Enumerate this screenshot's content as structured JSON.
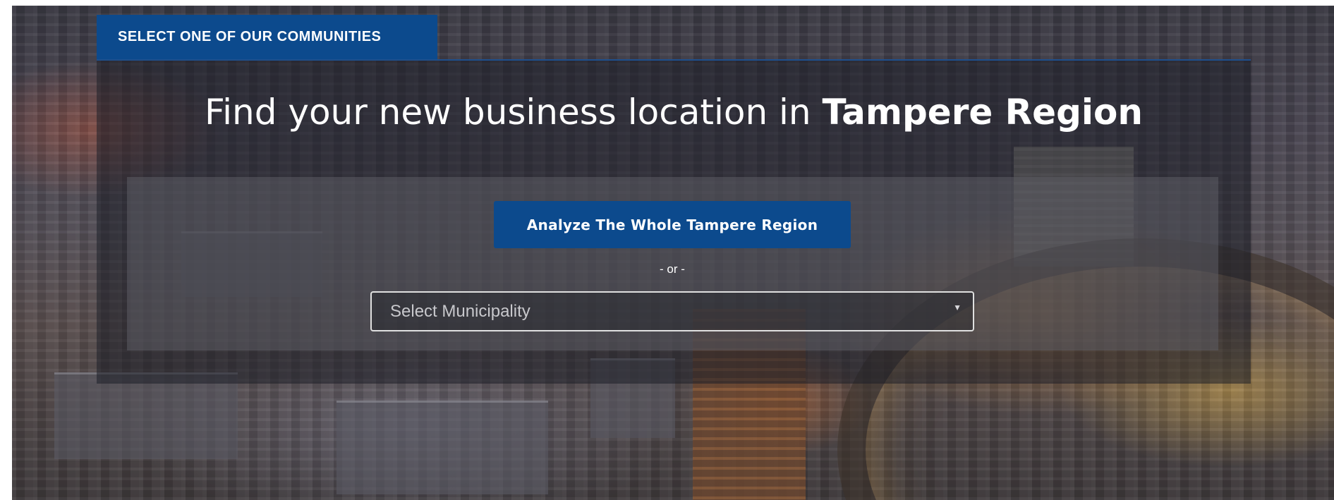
{
  "header": {
    "tab_label": "SELECT ONE OF OUR COMMUNITIES"
  },
  "headline": {
    "prefix": "Find your new business location in ",
    "emphasis": "Tampere Region"
  },
  "actions": {
    "analyze_label": "Analyze The Whole Tampere Region",
    "or_label": "- or -"
  },
  "municipality_select": {
    "selected_value": "Select Municipality",
    "arrow_icon": "dropdown-arrow-icon"
  },
  "colors": {
    "brand_blue": "#0c4a8d",
    "text_white": "#ffffff",
    "select_border": "#e0e0e0"
  }
}
